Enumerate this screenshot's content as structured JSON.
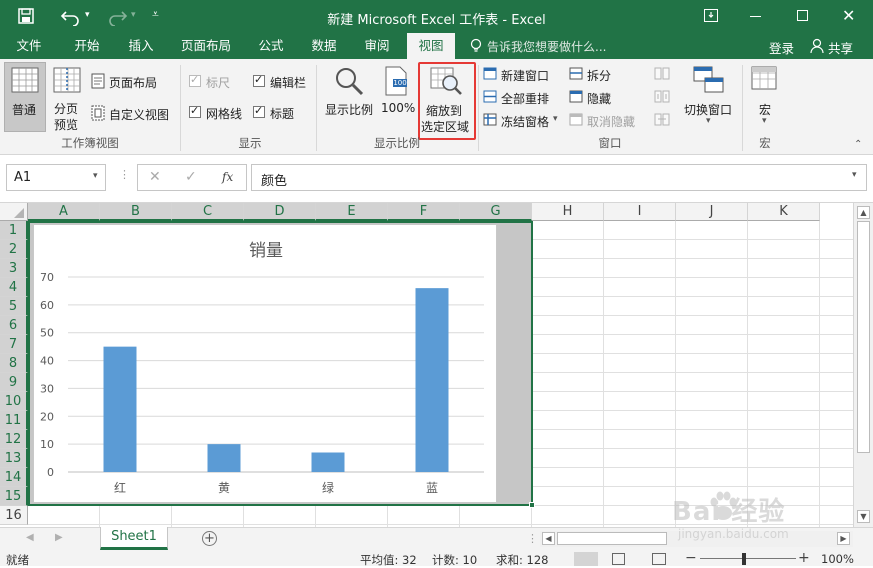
{
  "title_bar": {
    "title": "新建 Microsoft Excel 工作表 - Excel"
  },
  "tabs": [
    {
      "label": "文件"
    },
    {
      "label": "开始"
    },
    {
      "label": "插入"
    },
    {
      "label": "页面布局"
    },
    {
      "label": "公式"
    },
    {
      "label": "数据"
    },
    {
      "label": "审阅"
    },
    {
      "label": "视图"
    }
  ],
  "tell_me": "告诉我您想要做什么...",
  "login": "登录",
  "share": "共享",
  "ribbon": {
    "workbook_views": {
      "normal": "普通",
      "page_break_1": "分页",
      "page_break_2": "预览",
      "page_layout": "页面布局",
      "custom_views": "自定义视图",
      "group": "工作簿视图"
    },
    "show": {
      "ruler": "标尺",
      "formula_bar": "编辑栏",
      "gridlines": "网格线",
      "headings": "标题",
      "group": "显示"
    },
    "zoom": {
      "zoom": "显示比例",
      "zoom100": "100%",
      "zoom_icon_text": "100",
      "zoom_sel_1": "缩放到",
      "zoom_sel_2": "选定区域",
      "group": "显示比例"
    },
    "window": {
      "new_window": "新建窗口",
      "arrange_all": "全部重排",
      "freeze": "冻结窗格",
      "split": "拆分",
      "hide": "隐藏",
      "unhide": "取消隐藏",
      "switch": "切换窗口",
      "group": "窗口"
    },
    "macros": {
      "label": "宏",
      "group": "宏"
    }
  },
  "formula_bar": {
    "name_box": "A1",
    "fx": "fx",
    "value": "颜色"
  },
  "columns": [
    "A",
    "B",
    "C",
    "D",
    "E",
    "F",
    "G",
    "H",
    "I",
    "J",
    "K"
  ],
  "rows": [
    "1",
    "2",
    "3",
    "4",
    "5",
    "6",
    "7",
    "8",
    "9",
    "10",
    "11",
    "12",
    "13",
    "14",
    "15",
    "16"
  ],
  "chart_data": {
    "type": "bar",
    "title": "销量",
    "categories": [
      "红",
      "黄",
      "绿",
      "蓝"
    ],
    "values": [
      45,
      10,
      7,
      66
    ],
    "ylim": [
      0,
      70
    ],
    "yticks": [
      "0",
      "10",
      "20",
      "30",
      "40",
      "50",
      "60",
      "70"
    ],
    "grid": true,
    "color": "#5b9bd5"
  },
  "sheet_tabs": [
    {
      "label": "Sheet1"
    }
  ],
  "status": {
    "ready": "就绪",
    "average": "平均值: 32",
    "count": "计数: 10",
    "sum": "求和: 128",
    "zoom": "100%"
  },
  "watermark": {
    "brand": "Bai 经验",
    "url": "jingyan.baidu.com"
  },
  "colors": {
    "excel_green": "#217346",
    "highlight": "#e53935"
  }
}
